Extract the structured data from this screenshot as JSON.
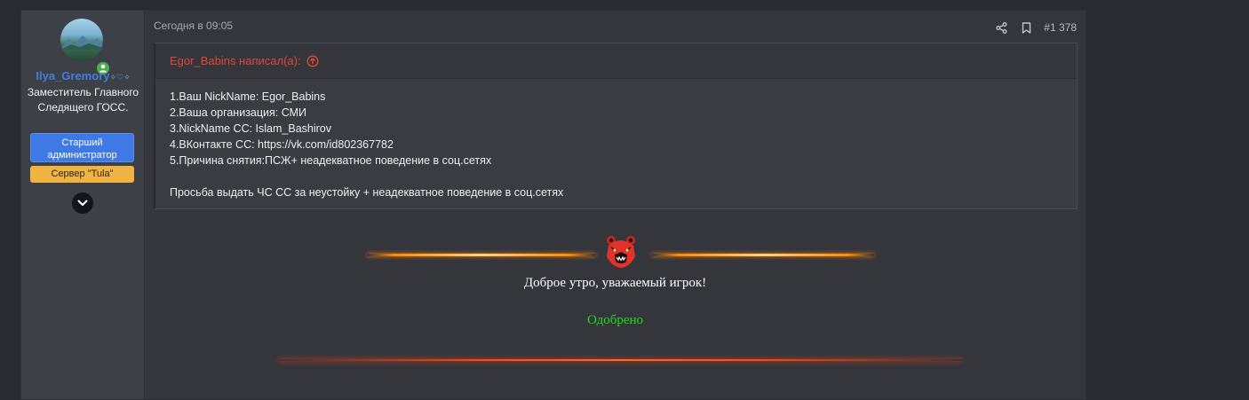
{
  "author": {
    "username": "Ilya_Gremory",
    "username_decoration": "✧♡✧",
    "user_title": "Заместитель Главного Следящего ГОСС.",
    "role_badge": "Старший администратор",
    "server_badge": "Сервер \"Tula\"",
    "online": true,
    "expand_icon": "chevron-down-icon",
    "colors": {
      "username": "#3f7fe0",
      "role_badge": "#3e79e6",
      "server_badge": "#f1b443",
      "online": "#4caf50"
    }
  },
  "post": {
    "timestamp": "Сегодня в 09:05",
    "number": "#1 378",
    "actions": [
      "share-icon",
      "bookmark-icon"
    ]
  },
  "quote": {
    "header": "Egor_Babins написал(а):",
    "jump_icon": "arrow-up-circle-icon",
    "lines": [
      "1.Ваш NickName: Egor_Babins",
      "2.Ваша организация: СМИ",
      "3.NickName CC: Islam_Bashirov",
      "4.ВКонтакте CC: https://vk.com/id802367782",
      "5.Причина снятия:ПСЖ+ неадекватное поведение в соц.сетях"
    ],
    "request": "Просьба выдать ЧС СС за неустойку + неадекватное поведение в соц.сетях",
    "header_color": "#e0463a"
  },
  "reply": {
    "greeting": "Доброе утро, уважаемый игрок!",
    "status": "Одобрено",
    "status_color": "#1fd81f",
    "emblem_icon": "bear-logo-icon"
  }
}
